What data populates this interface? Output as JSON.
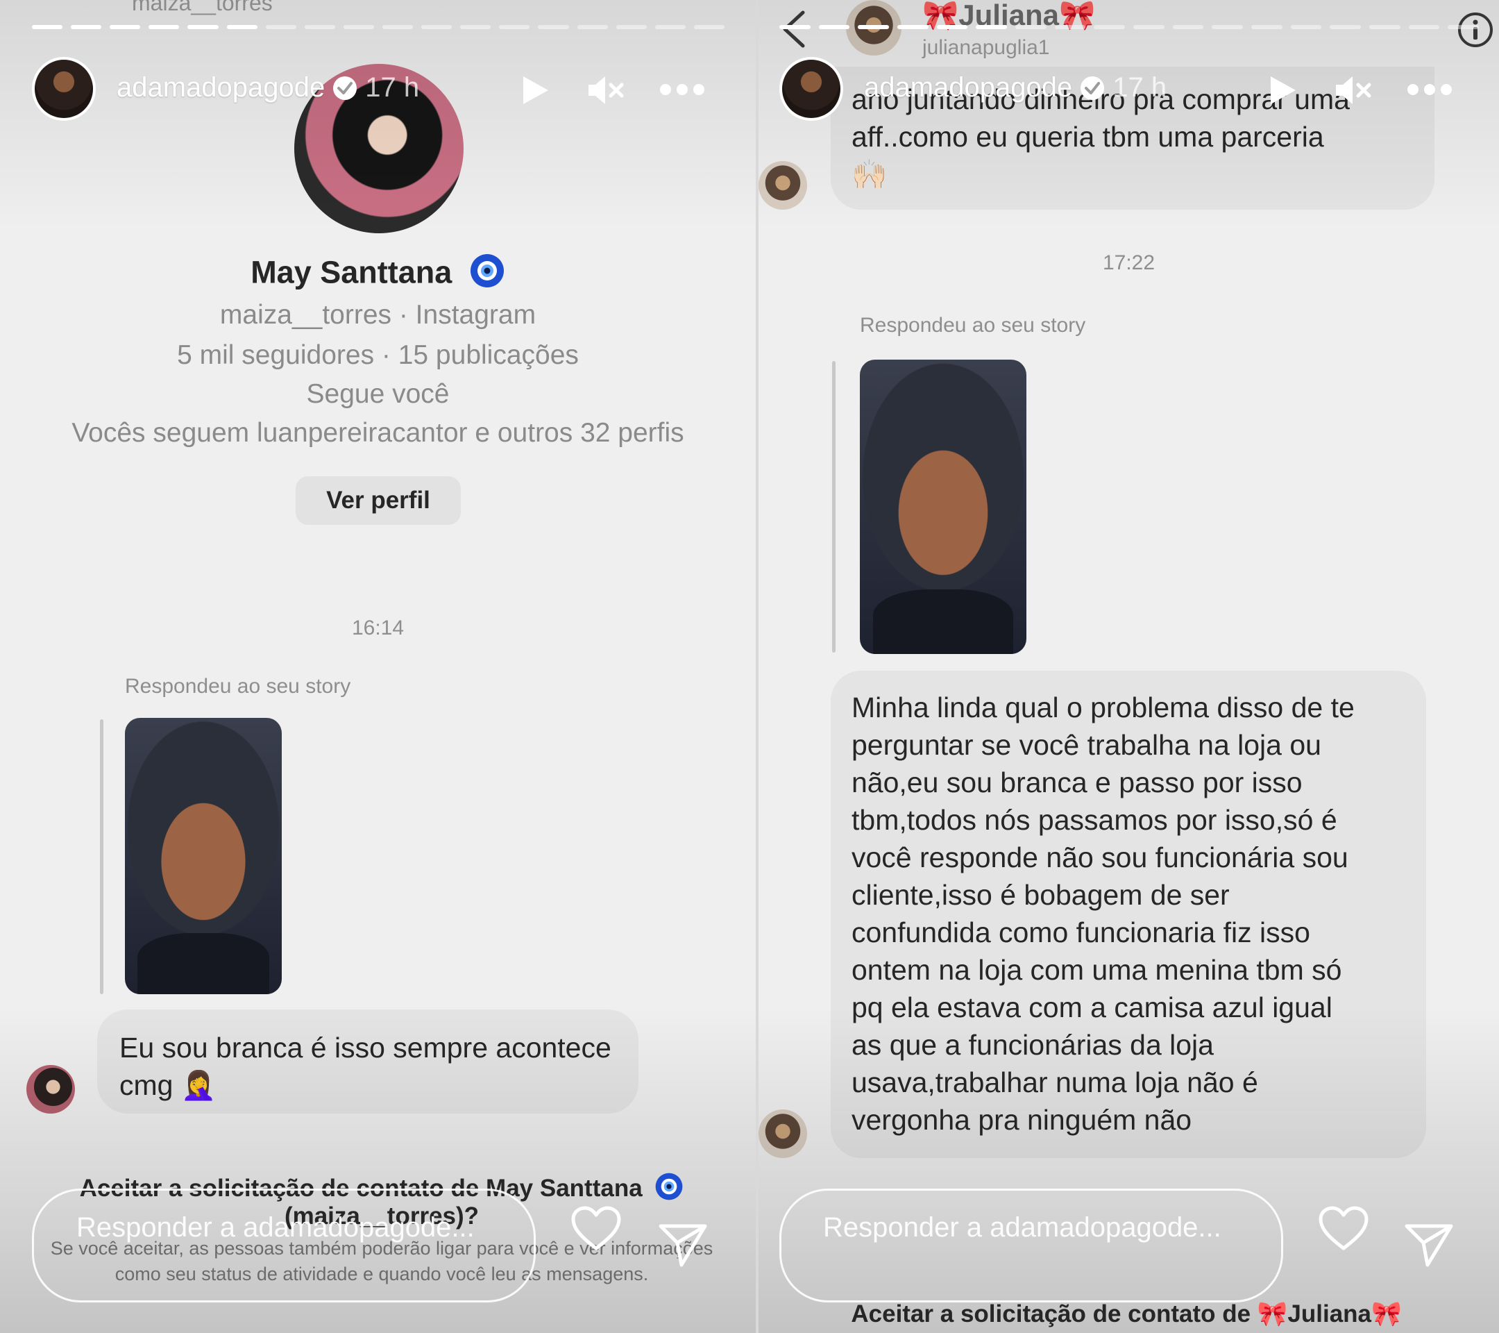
{
  "story": {
    "username": "adamadopagode",
    "time": "17 h",
    "reply_placeholder": "Responder a adamadopagode..."
  },
  "left": {
    "progress": {
      "segments": 18,
      "completed": 6
    },
    "profile": {
      "name": "May Santtana",
      "subtitle": "maiza__torres · Instagram",
      "stats": "5 mil seguidores · 15 publicações",
      "follows_you": "Segue você",
      "mutual": "Vocês seguem luanpereiracantor e outros 32 perfis",
      "view_profile": "Ver perfil",
      "badge_icon": "nazar-eye-icon"
    },
    "top_ghost_text": "maiza__torres",
    "timestamp": "16:14",
    "replied_label": "Respondeu ao seu story",
    "message": "Eu sou branca é isso sempre acontece cmg",
    "message_emoji": "🤦‍♀️",
    "accept_title_line1": "Aceitar a solicitação de contato de May Santtana",
    "accept_title_line2": "(maiza__torres)?",
    "accept_body": "Se você aceitar, as pessoas também poderão ligar para você e ver informações como seu status de atividade e quando você leu as mensagens."
  },
  "right": {
    "progress": {
      "segments": 18,
      "completed": 6
    },
    "chat_header": {
      "name": "Juliana",
      "handle": "julianapuglia1",
      "bow_emoji": "🎀"
    },
    "prev_message_line1": "ano juntando dinheiro pra comprar uma",
    "prev_message_line2": "aff..como eu queria tbm uma parceria",
    "prev_message_emoji": "🙌🏻",
    "timestamp": "17:22",
    "replied_label": "Respondeu ao seu story",
    "message_lines": [
      "Minha linda qual o problema disso de te",
      "perguntar se você trabalha na loja ou",
      "não,eu sou branca e passo por isso",
      "tbm,todos nós passamos por isso,só é",
      "você responde não sou funcionária sou",
      "cliente,isso é bobagem de ser",
      "confundida como funcionaria fiz isso",
      "ontem na loja com uma menina tbm só",
      "pq ela estava com a camisa azul igual",
      "as que a funcionárias da loja",
      "usava,trabalhar numa loja não é",
      "vergonha pra ninguém não"
    ],
    "accept_title": "Aceitar a solicitação de contato de 🎀Juliana🎀"
  },
  "colors": {
    "badge_blue": "#1f4fd1",
    "bubble": "#e4e4e4",
    "bow_pink": "#e0699b"
  }
}
